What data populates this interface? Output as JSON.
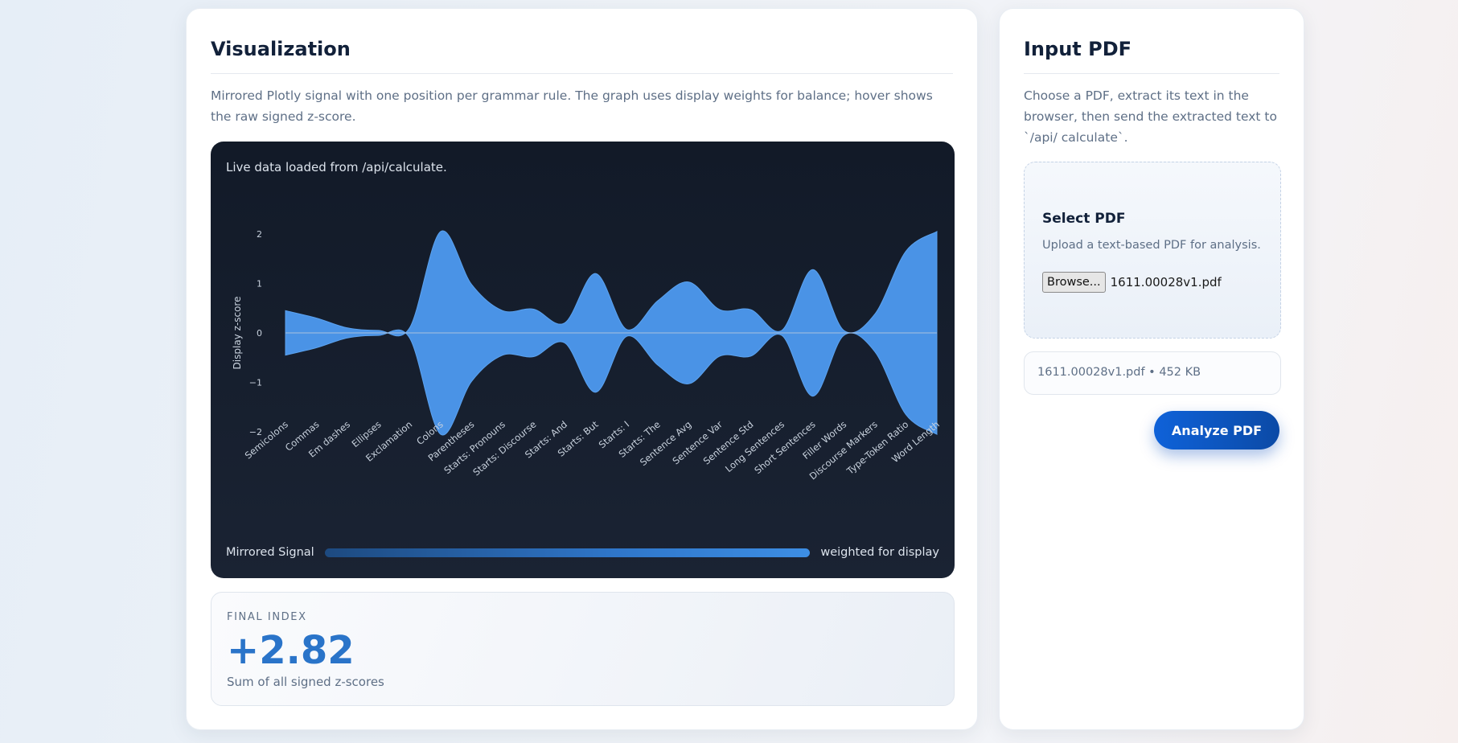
{
  "visualization": {
    "title": "Visualization",
    "description": "Mirrored Plotly signal with one position per grammar rule. The graph uses display weights for balance; hover shows the raw signed z-score.",
    "status": "Live data loaded from /api/calculate.",
    "legend_label": "Mirrored Signal",
    "legend_note": "weighted for display",
    "accent_color": "#4a93e6"
  },
  "chart_data": {
    "type": "area",
    "categories": [
      "Semicolons",
      "Commas",
      "Em dashes",
      "Ellipses",
      "Exclamation",
      "Colons",
      "Parentheses",
      "Starts: Pronouns",
      "Starts: Discourse",
      "Starts: And",
      "Starts: But",
      "Starts: I",
      "Starts: The",
      "Sentence Avg",
      "Sentence Var",
      "Sentence Std",
      "Long Sentences",
      "Short Sentences",
      "Filler Words",
      "Discourse Markers",
      "Type-Token Ratio",
      "Word Length"
    ],
    "values": [
      0.45,
      0.3,
      0.1,
      0.05,
      0.1,
      2.05,
      0.98,
      0.45,
      0.48,
      0.2,
      1.2,
      0.07,
      0.65,
      1.03,
      0.47,
      0.47,
      0.05,
      1.28,
      0.05,
      0.38,
      1.65,
      2.05
    ],
    "mirrored": true,
    "ylabel": "Display z-score",
    "yticks": [
      2,
      1,
      0,
      -1,
      -2
    ],
    "ylim": [
      -2.35,
      2.35
    ],
    "fill_color": "#4a93e6"
  },
  "final_index": {
    "label": "FINAL INDEX",
    "value": "+2.82",
    "caption": "Sum of all signed z-scores"
  },
  "input": {
    "title": "Input PDF",
    "description": "Choose a PDF, extract its text in the browser, then send the extracted text to `/api/ calculate`.",
    "upload_title": "Select PDF",
    "upload_desc": "Upload a text-based PDF for analysis.",
    "browse_label": "Browse...",
    "chosen_file": "1611.00028v1.pdf",
    "file_info": "1611.00028v1.pdf • 452 KB",
    "analyze_label": "Analyze PDF"
  }
}
